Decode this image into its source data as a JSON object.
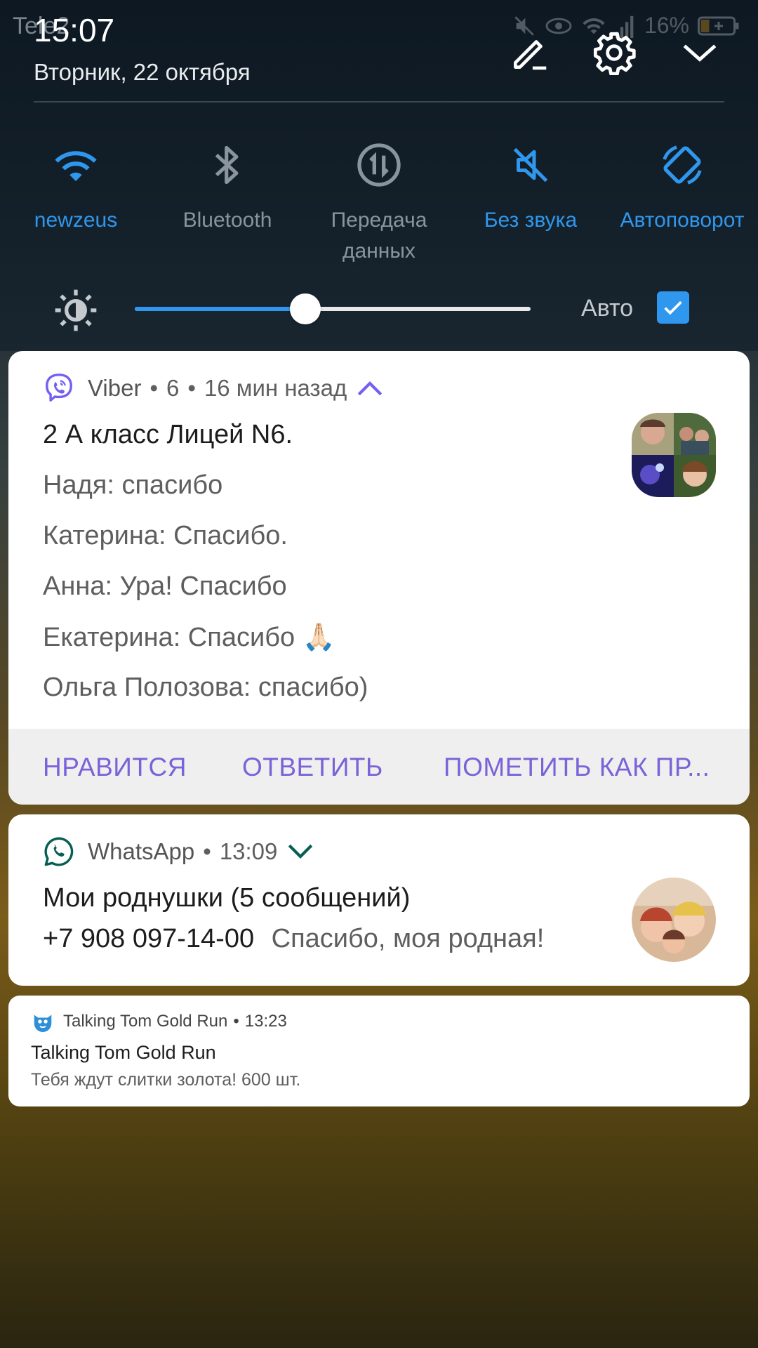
{
  "status_bar": {
    "carrier": "Tele2",
    "time": "15:07",
    "date": "Вторник, 22 октября",
    "battery": "16%"
  },
  "quick_toggles": [
    {
      "label": "newzeus",
      "icon": "wifi-icon",
      "state": "on"
    },
    {
      "label": "Bluetooth",
      "icon": "bluetooth-icon",
      "state": "off"
    },
    {
      "label": "Передача данных",
      "icon": "mobile-data-icon",
      "state": "off"
    },
    {
      "label": "Без звука",
      "icon": "mute-icon",
      "state": "on"
    },
    {
      "label": "Автоповорот",
      "icon": "autorotate-icon",
      "state": "on"
    }
  ],
  "brightness": {
    "level": 0.43,
    "auto_label": "Авто",
    "auto_checked": true
  },
  "viber": {
    "app": "Viber",
    "count": "6",
    "time": "16 мин назад",
    "title": "2 А класс Лицей N6.",
    "messages": [
      "Надя: спасибо",
      "Катерина: Спасибо.",
      "Анна: Ура! Спасибо",
      "Екатерина: Спасибо 🙏🏻",
      "Ольга Полозова: спасибо)"
    ],
    "actions": [
      "НРАВИТСЯ",
      "ОТВЕТИТЬ",
      "ПОМЕТИТЬ КАК ПР..."
    ],
    "accent": "#7360f2"
  },
  "whatsapp": {
    "app": "WhatsApp",
    "time": "13:09",
    "title": "Мои роднушки  (5 сообщений)",
    "sender": "+7 908 097-14-00",
    "text": "Спасибо, моя родная!",
    "accent": "#075e54"
  },
  "talkingtom": {
    "app": "Talking Tom Gold Run",
    "time": "13:23",
    "title": "Talking Tom Gold Run",
    "text": "Тебя ждут слитки золота! 600 шт."
  }
}
